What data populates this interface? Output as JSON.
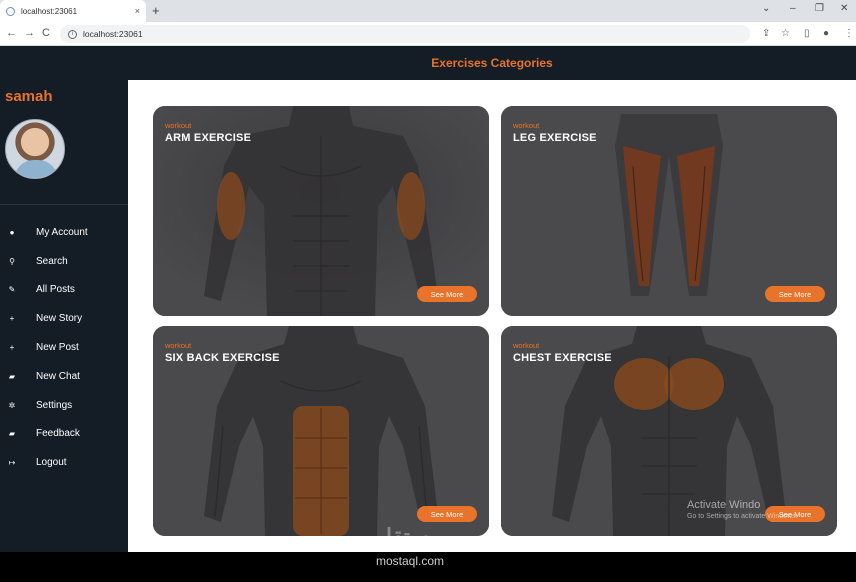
{
  "browser": {
    "tab_title": "localhost:23061",
    "tab_close": "×",
    "new_tab": "+",
    "url": "localhost:23061",
    "window_controls": [
      "⌄",
      "–",
      "❐",
      "✕"
    ],
    "nav": [
      "←",
      "→",
      "C"
    ],
    "tools": [
      "⇪",
      "☆",
      "▯",
      "●",
      "⋮"
    ]
  },
  "sidebar": {
    "username": "samah",
    "items": [
      {
        "icon": "user-icon",
        "glyph": "●",
        "label": "My Account"
      },
      {
        "icon": "search-icon",
        "glyph": "⚲",
        "label": "Search"
      },
      {
        "icon": "edit-icon",
        "glyph": "✎",
        "label": "All Posts"
      },
      {
        "icon": "plus-icon",
        "glyph": "+",
        "label": "New Story"
      },
      {
        "icon": "plus-icon",
        "glyph": "+",
        "label": "New Post"
      },
      {
        "icon": "chat-icon",
        "glyph": "▰",
        "label": "New Chat"
      },
      {
        "icon": "gear-icon",
        "glyph": "✲",
        "label": "Settings"
      },
      {
        "icon": "feedback-icon",
        "glyph": "▰",
        "label": "Feedback"
      },
      {
        "icon": "logout-icon",
        "glyph": "↦",
        "label": "Logout"
      }
    ]
  },
  "header": {
    "title": "Exercises Categories"
  },
  "cards": [
    {
      "kicker": "workout",
      "title": "ARM EXERCISE",
      "button": "See More"
    },
    {
      "kicker": "workout",
      "title": "LEG EXERCISE",
      "button": "See More"
    },
    {
      "kicker": "workout",
      "title": "SIX BACK EXERCISE",
      "button": "See More"
    },
    {
      "kicker": "workout",
      "title": "CHEST EXERCISE",
      "button": "See More"
    }
  ],
  "overlay": {
    "activate_title": "Activate Windo",
    "activate_sub": "Go to Settings to activate Windows.",
    "watermark_logo": "مستقل",
    "watermark_text": "mostaql.com"
  },
  "colors": {
    "accent": "#e8732a",
    "sidebar": "#141c26",
    "card": "#4a494b"
  }
}
